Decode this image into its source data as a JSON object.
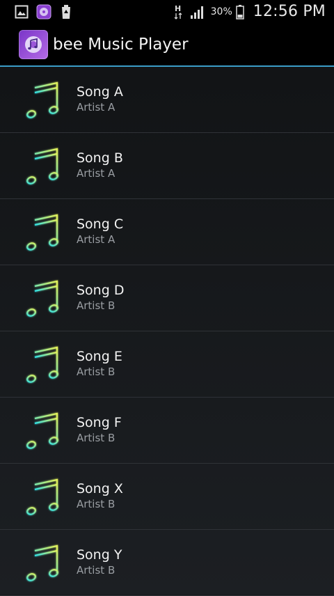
{
  "status_bar": {
    "battery_percent": "30%",
    "time": "12:56 PM",
    "icons": [
      "gallery-notification-icon",
      "music-notification-icon",
      "recycle-notification-icon",
      "hspa-icon",
      "signal-icon",
      "battery-icon"
    ]
  },
  "action_bar": {
    "title": "bee Music Player",
    "icon": "music-app-icon"
  },
  "songs": [
    {
      "title": "Song A",
      "artist": "Artist A"
    },
    {
      "title": "Song B",
      "artist": "Artist A"
    },
    {
      "title": "Song C",
      "artist": "Artist A"
    },
    {
      "title": "Song D",
      "artist": "Artist B"
    },
    {
      "title": "Song E",
      "artist": "Artist B"
    },
    {
      "title": "Song F",
      "artist": "Artist B"
    },
    {
      "title": "Song X",
      "artist": "Artist B"
    },
    {
      "title": "Song Y",
      "artist": "Artist B"
    }
  ]
}
